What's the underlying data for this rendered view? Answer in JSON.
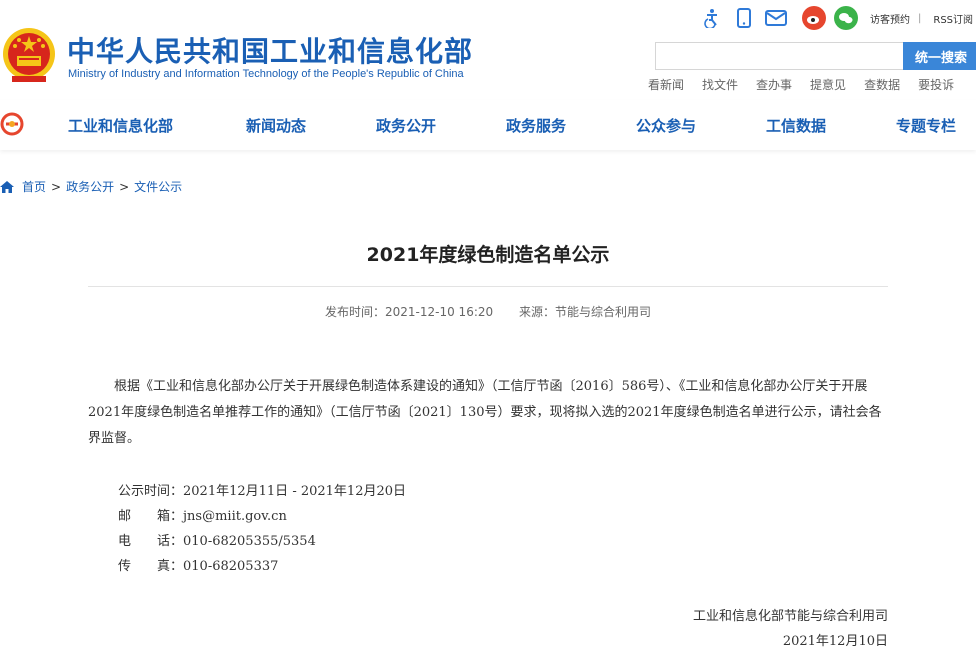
{
  "header": {
    "title_cn": "中华人民共和国工业和信息化部",
    "title_en": "Ministry of Industry and Information Technology of the People's Republic of China",
    "toolbar": {
      "visitor_label": "访客预约",
      "rss_label": "RSS订阅",
      "icons": [
        "accessibility-icon",
        "mobile-icon",
        "mail-icon",
        "weibo-icon",
        "wechat-icon"
      ]
    },
    "search": {
      "placeholder": "",
      "button_label": "统一搜索"
    },
    "quick_links": [
      "看新闻",
      "找文件",
      "查办事",
      "提意见",
      "查数据",
      "要投诉"
    ]
  },
  "nav": {
    "items": [
      "工业和信息化部",
      "新闻动态",
      "政务公开",
      "政务服务",
      "公众参与",
      "工信数据",
      "专题专栏"
    ]
  },
  "breadcrumb": {
    "items": [
      "首页",
      "政务公开",
      "文件公示"
    ],
    "separator": ">"
  },
  "article": {
    "title": "2021年度绿色制造名单公示",
    "publish_label": "发布时间：2021-12-10 16:20",
    "source_label": "来源：节能与综合利用司",
    "body": "根据《工业和信息化部办公厅关于开展绿色制造体系建设的通知》（工信厅节函〔2016〕586号）、《工业和信息化部办公厅关于开展2021年度绿色制造名单推荐工作的通知》（工信厅节函〔2021〕130号）要求，现将拟入选的2021年度绿色制造名单进行公示，请社会各界监督。",
    "contact": [
      {
        "label": "公示时间：",
        "value": "2021年12月11日 - 2021年12月20日"
      },
      {
        "label": "邮　　箱：",
        "value": "jns@miit.gov.cn"
      },
      {
        "label": "电　　话：",
        "value": "010-68205355/5354"
      },
      {
        "label": "传　　真：",
        "value": "010-68205337"
      }
    ],
    "signature": "工业和信息化部节能与综合利用司",
    "date": "2021年12月10日"
  },
  "colors": {
    "brand_blue": "#1a5fb4",
    "search_button": "#3a86d8",
    "emblem_red": "#d7261c",
    "emblem_gold": "#f5c518"
  }
}
